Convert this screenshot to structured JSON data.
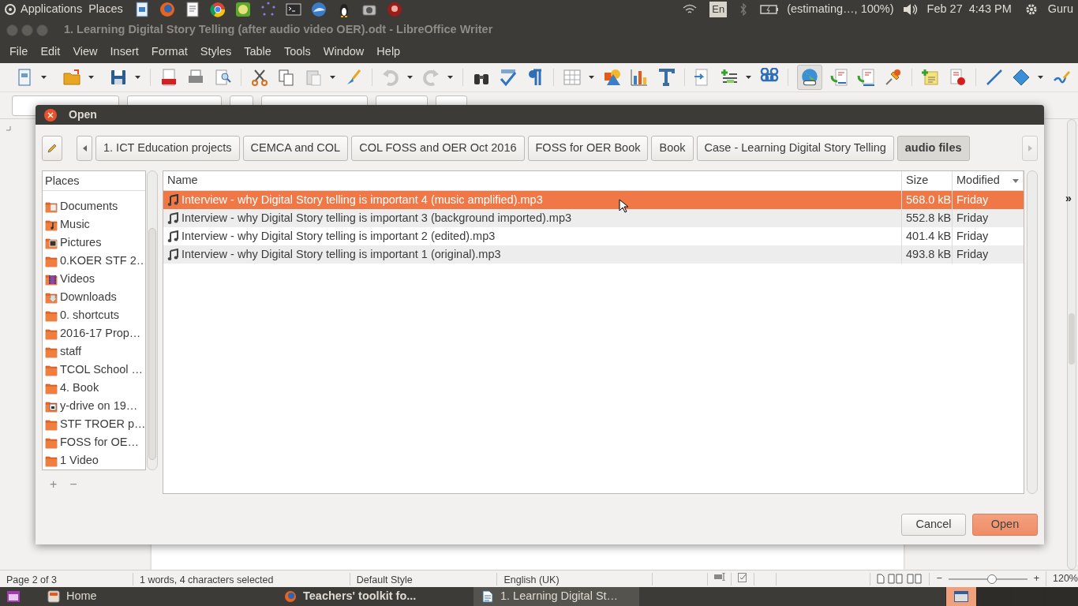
{
  "top_panel": {
    "menus": [
      "Applications",
      "Places"
    ],
    "keyboard": "En",
    "battery": "(estimating…, 100%)",
    "date": "Feb 27",
    "time": "4:43 PM",
    "user": "Guru"
  },
  "window": {
    "title": "1. Learning Digital Story Telling (after audio video OER).odt - LibreOffice Writer"
  },
  "menu": [
    "File",
    "Edit",
    "View",
    "Insert",
    "Format",
    "Styles",
    "Table",
    "Tools",
    "Window",
    "Help"
  ],
  "toolbar_overflow": "»",
  "dialog": {
    "title": "Open",
    "path": [
      {
        "label": "1. ICT Education projects",
        "selected": false
      },
      {
        "label": "CEMCA and COL",
        "selected": false
      },
      {
        "label": "COL FOSS and OER Oct 2016",
        "selected": false
      },
      {
        "label": "FOSS for OER Book",
        "selected": false
      },
      {
        "label": "Book",
        "selected": false
      },
      {
        "label": "Case - Learning Digital Story Telling",
        "selected": false
      },
      {
        "label": "audio files",
        "selected": true
      }
    ],
    "places": {
      "header": "Places",
      "items": [
        {
          "label": "Documents",
          "kind": "documents"
        },
        {
          "label": "Music",
          "kind": "music"
        },
        {
          "label": "Pictures",
          "kind": "pictures"
        },
        {
          "label": "0.KOER STF 2…",
          "kind": "folder"
        },
        {
          "label": "Videos",
          "kind": "videos"
        },
        {
          "label": "Downloads",
          "kind": "downloads"
        },
        {
          "label": "0. shortcuts",
          "kind": "folder"
        },
        {
          "label": "2016-17 Prop…",
          "kind": "folder"
        },
        {
          "label": "staff",
          "kind": "folder"
        },
        {
          "label": "TCOL School …",
          "kind": "folder"
        },
        {
          "label": "4. Book",
          "kind": "folder"
        },
        {
          "label": "y-drive on 19…",
          "kind": "network"
        },
        {
          "label": "STF TROER  p…",
          "kind": "folder"
        },
        {
          "label": "FOSS for OE…",
          "kind": "folder"
        },
        {
          "label": "1 Video",
          "kind": "folder"
        }
      ],
      "add": "+",
      "remove": "−"
    },
    "files": {
      "columns": [
        {
          "label": "Name",
          "sorted": false
        },
        {
          "label": "Size",
          "sorted": false
        },
        {
          "label": "Modified",
          "sorted": true
        }
      ],
      "rows": [
        {
          "name": "Interview - why Digital Story telling is important 4 (music amplified).mp3",
          "size": "568.0 kB",
          "modified": "Friday",
          "selected": true
        },
        {
          "name": "Interview - why Digital Story telling is important 3 (background imported).mp3",
          "size": "552.8 kB",
          "modified": "Friday",
          "selected": false
        },
        {
          "name": "Interview - why Digital Story telling is important 2 (edited).mp3",
          "size": "401.4 kB",
          "modified": "Friday",
          "selected": false
        },
        {
          "name": "Interview - why Digital Story telling is important 1 (original).mp3",
          "size": "493.8 kB",
          "modified": "Friday",
          "selected": false
        }
      ]
    },
    "buttons": [
      {
        "label": "Cancel",
        "kind": "secondary"
      },
      {
        "label": "Open",
        "kind": "primary"
      }
    ]
  },
  "status_bar": {
    "page": "Page 2 of 3",
    "selection": "1 words, 4 characters selected",
    "style": "Default Style",
    "language": "English (UK)",
    "zoom_minus": "−",
    "zoom_plus": "+",
    "zoom_slider": {
      "level": 0.55
    },
    "zoom": "120%"
  },
  "taskbar": {
    "items": [
      {
        "label": "Home",
        "kind": "files",
        "selected": false,
        "attention": false
      },
      {
        "label": "Teachers' toolkit fo...",
        "kind": "browser",
        "selected": false,
        "attention": true
      },
      {
        "label": "1. Learning Digital St…",
        "kind": "document",
        "selected": true,
        "attention": false
      }
    ],
    "workspaces": [
      {
        "selected": true
      },
      {
        "selected": false
      },
      {
        "selected": false
      },
      {
        "selected": false
      }
    ]
  }
}
